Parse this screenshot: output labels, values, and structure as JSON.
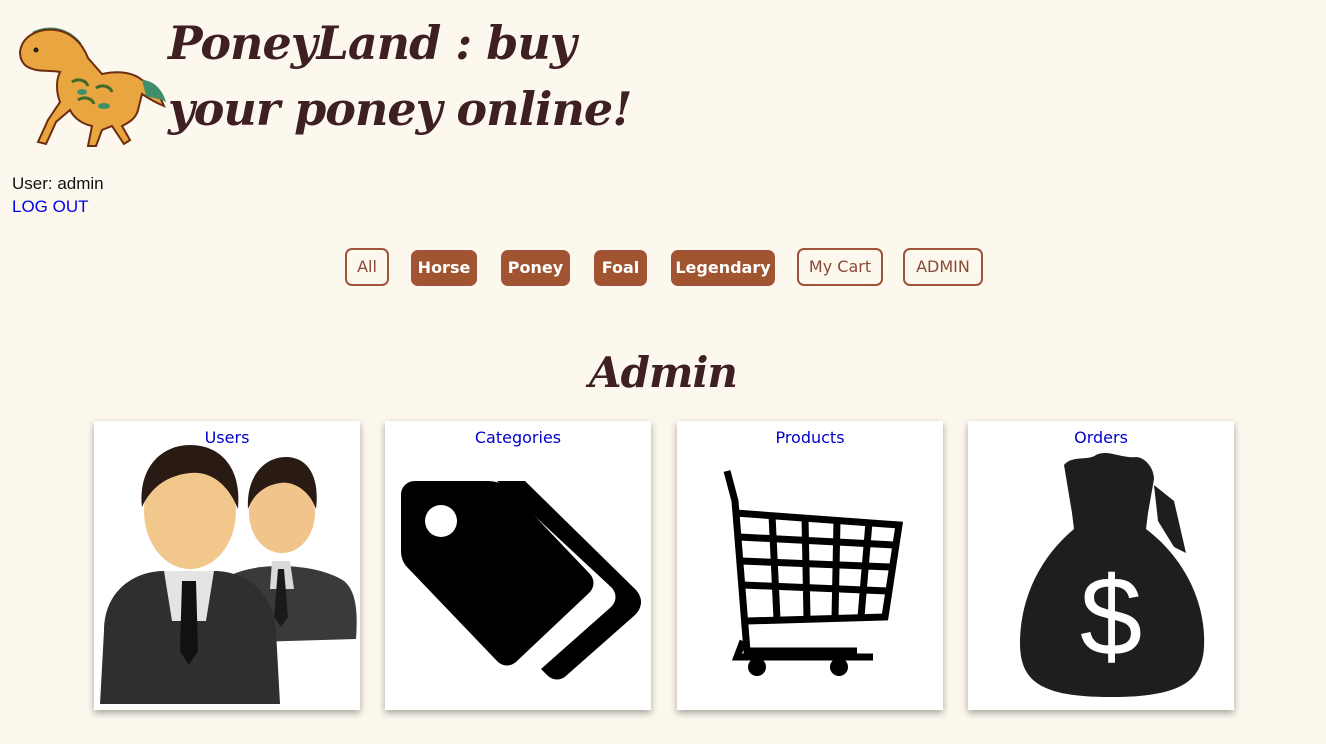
{
  "header": {
    "title": "PoneyLand : buy your poney online!",
    "logo_icon": "horse-logo-icon"
  },
  "session": {
    "user_label": "User: admin",
    "logout_label": "LOG OUT"
  },
  "nav": {
    "items": [
      {
        "label": "All",
        "style": "outline"
      },
      {
        "label": "Horse",
        "style": "filled"
      },
      {
        "label": "Poney",
        "style": "filled"
      },
      {
        "label": "Foal",
        "style": "filled"
      },
      {
        "label": "Legendary",
        "style": "filled"
      },
      {
        "label": "My Cart",
        "style": "outline"
      },
      {
        "label": "ADMIN",
        "style": "outline"
      }
    ]
  },
  "main": {
    "heading": "Admin",
    "cards": [
      {
        "label": "Users",
        "icon": "users-icon"
      },
      {
        "label": "Categories",
        "icon": "tags-icon"
      },
      {
        "label": "Products",
        "icon": "shopping-cart-icon"
      },
      {
        "label": "Orders",
        "icon": "money-bag-icon"
      }
    ]
  },
  "colors": {
    "background": "#fdf8ee",
    "brand_brown": "#a0542f",
    "title_color": "#3e1f22",
    "link_blue": "#0000ee"
  }
}
